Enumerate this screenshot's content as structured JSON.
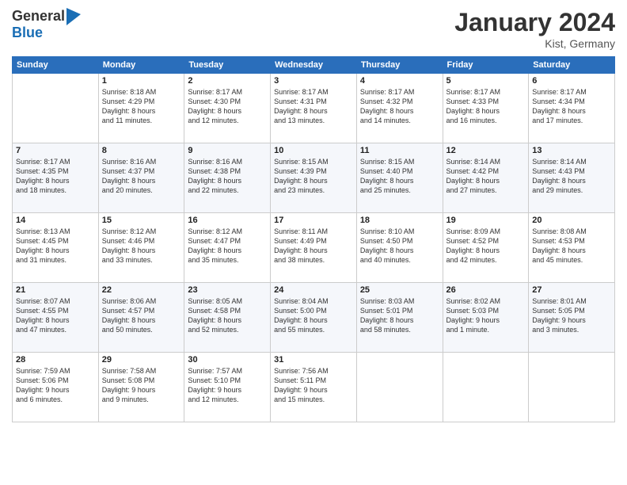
{
  "logo": {
    "general": "General",
    "blue": "Blue"
  },
  "header": {
    "month": "January 2024",
    "location": "Kist, Germany"
  },
  "weekdays": [
    "Sunday",
    "Monday",
    "Tuesday",
    "Wednesday",
    "Thursday",
    "Friday",
    "Saturday"
  ],
  "weeks": [
    [
      {
        "day": "",
        "info": ""
      },
      {
        "day": "1",
        "info": "Sunrise: 8:18 AM\nSunset: 4:29 PM\nDaylight: 8 hours\nand 11 minutes."
      },
      {
        "day": "2",
        "info": "Sunrise: 8:17 AM\nSunset: 4:30 PM\nDaylight: 8 hours\nand 12 minutes."
      },
      {
        "day": "3",
        "info": "Sunrise: 8:17 AM\nSunset: 4:31 PM\nDaylight: 8 hours\nand 13 minutes."
      },
      {
        "day": "4",
        "info": "Sunrise: 8:17 AM\nSunset: 4:32 PM\nDaylight: 8 hours\nand 14 minutes."
      },
      {
        "day": "5",
        "info": "Sunrise: 8:17 AM\nSunset: 4:33 PM\nDaylight: 8 hours\nand 16 minutes."
      },
      {
        "day": "6",
        "info": "Sunrise: 8:17 AM\nSunset: 4:34 PM\nDaylight: 8 hours\nand 17 minutes."
      }
    ],
    [
      {
        "day": "7",
        "info": "Sunrise: 8:17 AM\nSunset: 4:35 PM\nDaylight: 8 hours\nand 18 minutes."
      },
      {
        "day": "8",
        "info": "Sunrise: 8:16 AM\nSunset: 4:37 PM\nDaylight: 8 hours\nand 20 minutes."
      },
      {
        "day": "9",
        "info": "Sunrise: 8:16 AM\nSunset: 4:38 PM\nDaylight: 8 hours\nand 22 minutes."
      },
      {
        "day": "10",
        "info": "Sunrise: 8:15 AM\nSunset: 4:39 PM\nDaylight: 8 hours\nand 23 minutes."
      },
      {
        "day": "11",
        "info": "Sunrise: 8:15 AM\nSunset: 4:40 PM\nDaylight: 8 hours\nand 25 minutes."
      },
      {
        "day": "12",
        "info": "Sunrise: 8:14 AM\nSunset: 4:42 PM\nDaylight: 8 hours\nand 27 minutes."
      },
      {
        "day": "13",
        "info": "Sunrise: 8:14 AM\nSunset: 4:43 PM\nDaylight: 8 hours\nand 29 minutes."
      }
    ],
    [
      {
        "day": "14",
        "info": "Sunrise: 8:13 AM\nSunset: 4:45 PM\nDaylight: 8 hours\nand 31 minutes."
      },
      {
        "day": "15",
        "info": "Sunrise: 8:12 AM\nSunset: 4:46 PM\nDaylight: 8 hours\nand 33 minutes."
      },
      {
        "day": "16",
        "info": "Sunrise: 8:12 AM\nSunset: 4:47 PM\nDaylight: 8 hours\nand 35 minutes."
      },
      {
        "day": "17",
        "info": "Sunrise: 8:11 AM\nSunset: 4:49 PM\nDaylight: 8 hours\nand 38 minutes."
      },
      {
        "day": "18",
        "info": "Sunrise: 8:10 AM\nSunset: 4:50 PM\nDaylight: 8 hours\nand 40 minutes."
      },
      {
        "day": "19",
        "info": "Sunrise: 8:09 AM\nSunset: 4:52 PM\nDaylight: 8 hours\nand 42 minutes."
      },
      {
        "day": "20",
        "info": "Sunrise: 8:08 AM\nSunset: 4:53 PM\nDaylight: 8 hours\nand 45 minutes."
      }
    ],
    [
      {
        "day": "21",
        "info": "Sunrise: 8:07 AM\nSunset: 4:55 PM\nDaylight: 8 hours\nand 47 minutes."
      },
      {
        "day": "22",
        "info": "Sunrise: 8:06 AM\nSunset: 4:57 PM\nDaylight: 8 hours\nand 50 minutes."
      },
      {
        "day": "23",
        "info": "Sunrise: 8:05 AM\nSunset: 4:58 PM\nDaylight: 8 hours\nand 52 minutes."
      },
      {
        "day": "24",
        "info": "Sunrise: 8:04 AM\nSunset: 5:00 PM\nDaylight: 8 hours\nand 55 minutes."
      },
      {
        "day": "25",
        "info": "Sunrise: 8:03 AM\nSunset: 5:01 PM\nDaylight: 8 hours\nand 58 minutes."
      },
      {
        "day": "26",
        "info": "Sunrise: 8:02 AM\nSunset: 5:03 PM\nDaylight: 9 hours\nand 1 minute."
      },
      {
        "day": "27",
        "info": "Sunrise: 8:01 AM\nSunset: 5:05 PM\nDaylight: 9 hours\nand 3 minutes."
      }
    ],
    [
      {
        "day": "28",
        "info": "Sunrise: 7:59 AM\nSunset: 5:06 PM\nDaylight: 9 hours\nand 6 minutes."
      },
      {
        "day": "29",
        "info": "Sunrise: 7:58 AM\nSunset: 5:08 PM\nDaylight: 9 hours\nand 9 minutes."
      },
      {
        "day": "30",
        "info": "Sunrise: 7:57 AM\nSunset: 5:10 PM\nDaylight: 9 hours\nand 12 minutes."
      },
      {
        "day": "31",
        "info": "Sunrise: 7:56 AM\nSunset: 5:11 PM\nDaylight: 9 hours\nand 15 minutes."
      },
      {
        "day": "",
        "info": ""
      },
      {
        "day": "",
        "info": ""
      },
      {
        "day": "",
        "info": ""
      }
    ]
  ]
}
